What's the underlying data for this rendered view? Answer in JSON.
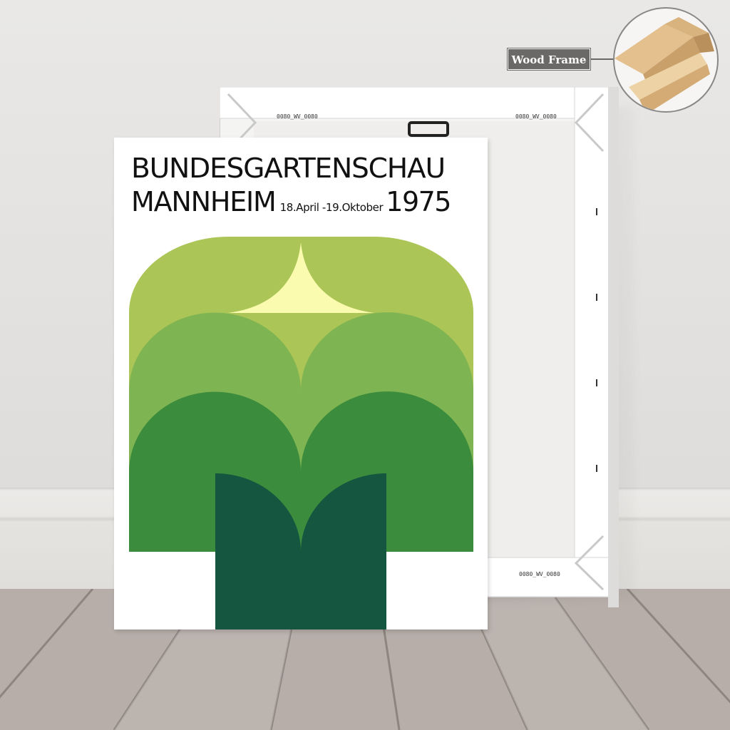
{
  "poster": {
    "title_line1": "BUNDESGARTENSCHAU",
    "title_city": "MANNHEIM",
    "dates": "18.April -19.Oktober",
    "year": "1975"
  },
  "badge": {
    "label": "Wood Frame"
  },
  "back_canvas": {
    "stamp_text": "0080_WV_0080"
  },
  "colors": {
    "light_green": "#abc556",
    "mid_green": "#7fb452",
    "green": "#3b8c3c",
    "dark_green": "#14563f",
    "pale_yellow": "#fbfbb0",
    "wall": "#e6e4e2",
    "floor": "#b4aba6"
  }
}
